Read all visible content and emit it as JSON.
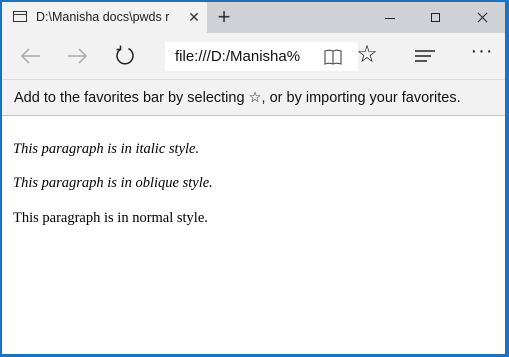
{
  "tab": {
    "title": "D:\\Manisha docs\\pwds r",
    "close_glyph": "✕"
  },
  "titlebar": {
    "new_tab_glyph": "+"
  },
  "navbar": {
    "address": "file:///D:/Manisha%",
    "favorite_glyph": "☆",
    "more_glyph": "···"
  },
  "favbar": {
    "message": "Add to the favorites bar by selecting ☆, or by importing your favorites."
  },
  "content": {
    "p_italic": "This paragraph is in italic style.",
    "p_oblique": "This paragraph is in oblique style.",
    "p_normal": "This paragraph is in normal style."
  },
  "icons": {
    "tab_page": "page-icon",
    "back": "arrow-left-icon",
    "forward": "arrow-right-icon",
    "refresh": "refresh-icon",
    "reading_view": "book-icon",
    "favorite": "star-icon",
    "hub": "hub-icon",
    "more": "more-icon"
  }
}
